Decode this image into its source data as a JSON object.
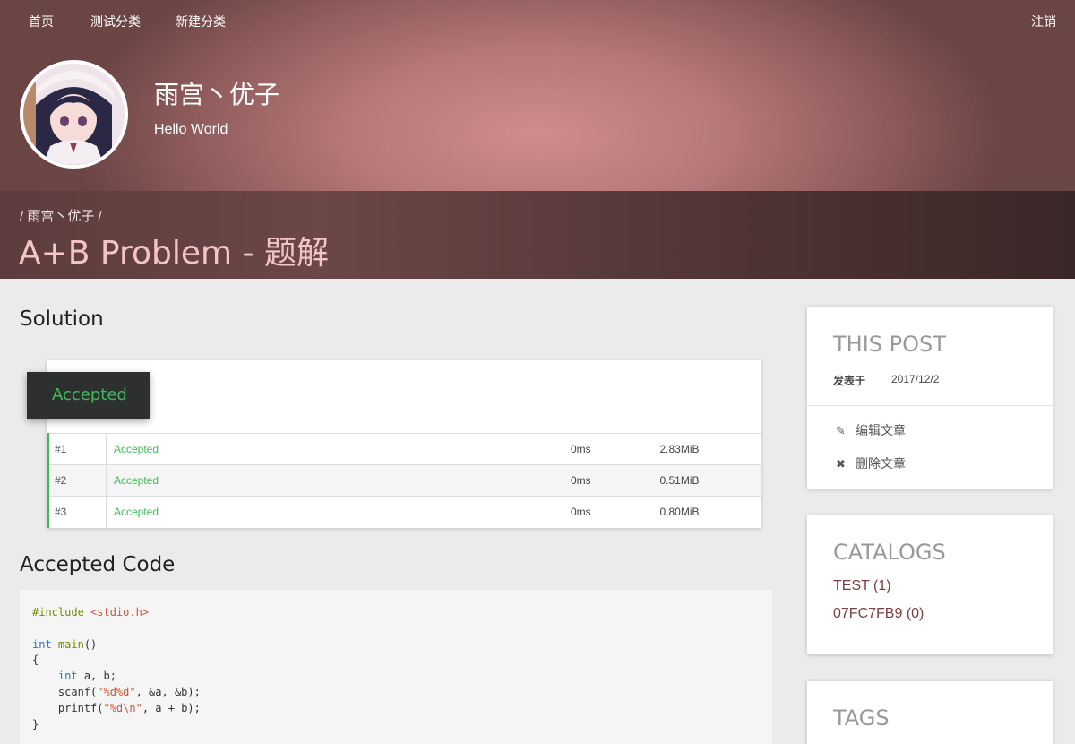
{
  "nav": {
    "home": "首页",
    "test_category": "测试分类",
    "new_category": "新建分类",
    "logout": "注销"
  },
  "site": {
    "title": "雨宫丶优子",
    "subtitle": "Hello World"
  },
  "post": {
    "breadcrumb": "/ 雨宫丶优子 /",
    "title": "A+B Problem - 题解"
  },
  "solution": {
    "heading": "Solution",
    "status": "Accepted",
    "rows": [
      {
        "id": "#1",
        "status": "Accepted",
        "time": "0ms",
        "memory": "2.83MiB"
      },
      {
        "id": "#2",
        "status": "Accepted",
        "time": "0ms",
        "memory": "0.51MiB"
      },
      {
        "id": "#3",
        "status": "Accepted",
        "time": "0ms",
        "memory": "0.80MiB"
      }
    ]
  },
  "code_section": {
    "heading": "Accepted Code"
  },
  "sidebar": {
    "this_post": {
      "title": "THIS POST",
      "published_label": "发表于",
      "published_date": "2017/12/2",
      "edit_label": "编辑文章",
      "delete_label": "删除文章"
    },
    "catalogs": {
      "title": "CATALOGS",
      "items": [
        "TEST (1)",
        "07FC7FB9 (0)"
      ]
    },
    "tags": {
      "title": "TAGS"
    }
  },
  "colors": {
    "accent_green": "#3fba5b",
    "catalog_link": "#7a3f3f",
    "banner": "#5c3c3c"
  },
  "icons": [
    "edit-icon",
    "close-icon"
  ]
}
